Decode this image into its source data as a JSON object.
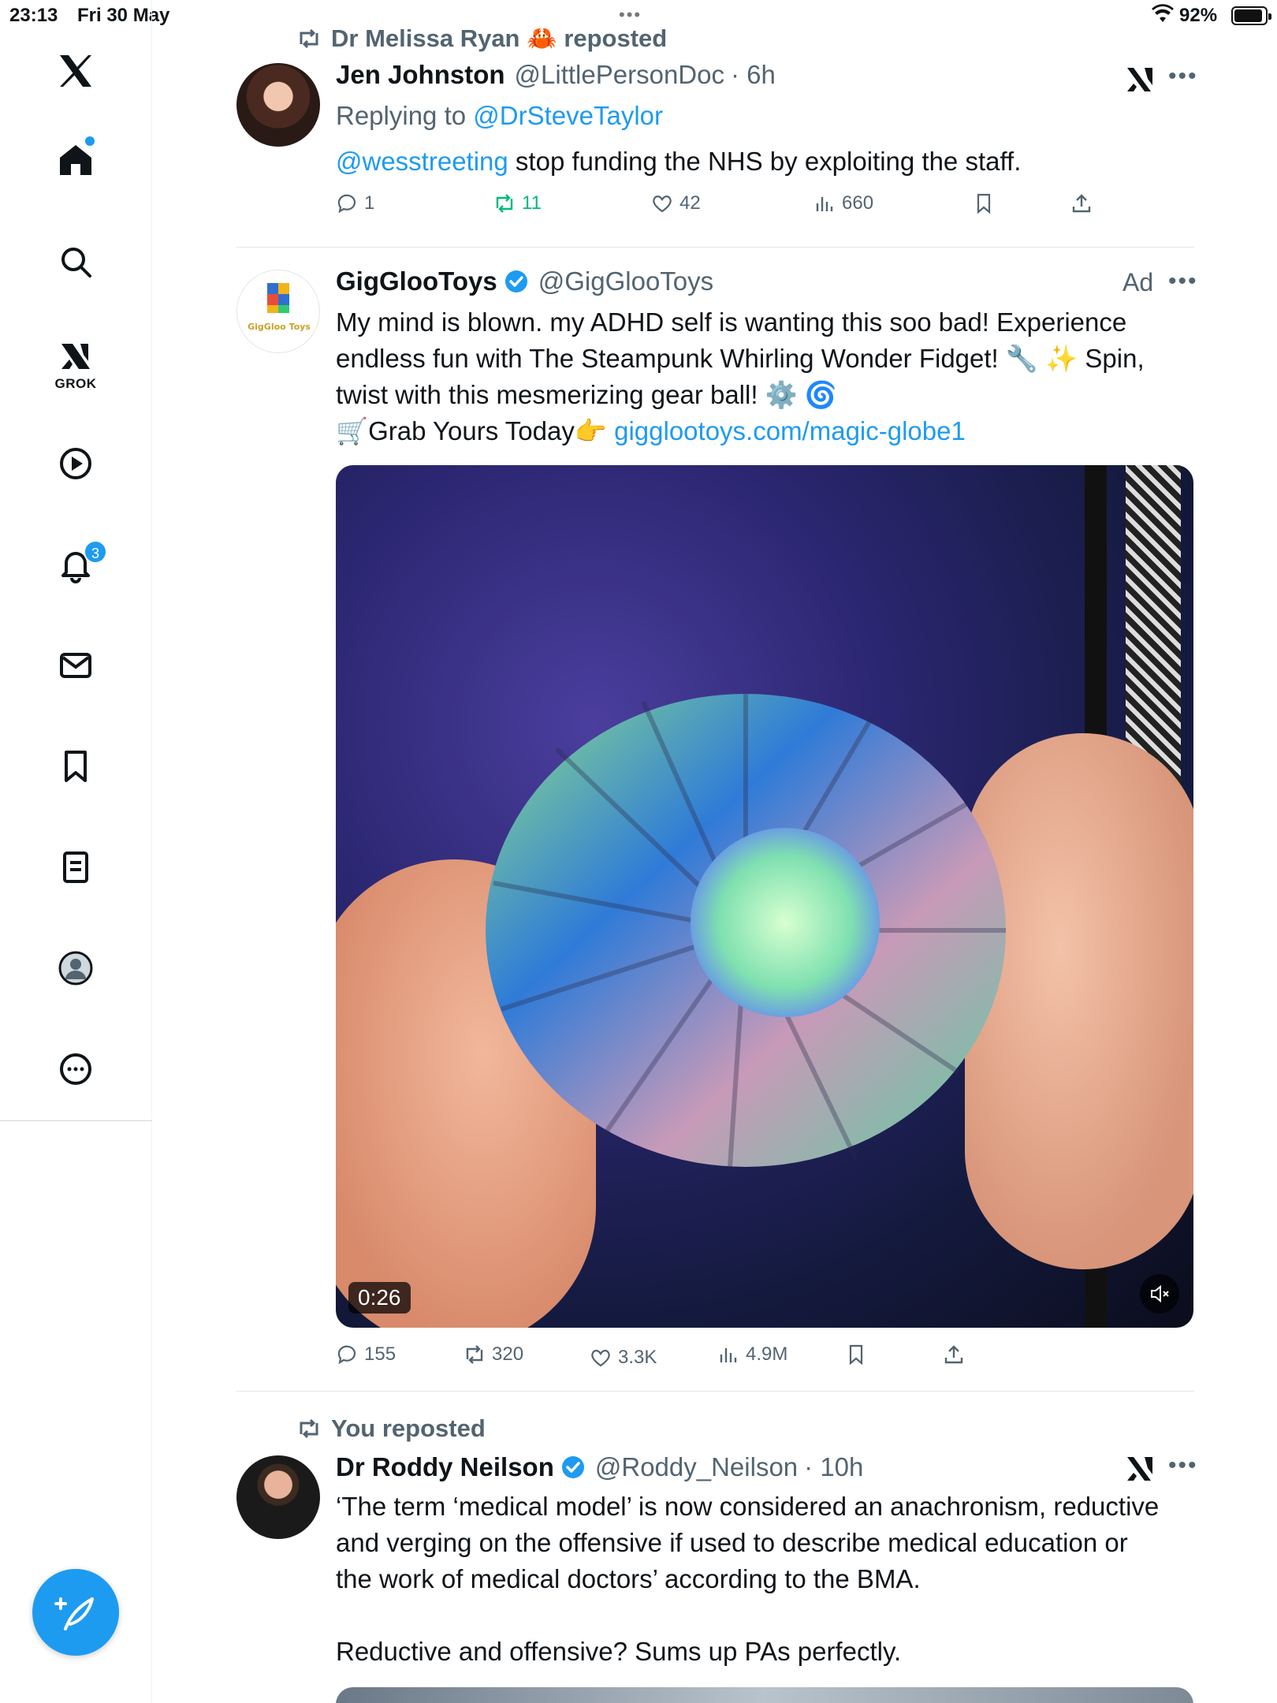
{
  "status_bar": {
    "time": "23:13",
    "date": "Fri 30 May",
    "battery": "92%"
  },
  "sidebar": {
    "grok_label": "GROK",
    "notification_count": "3",
    "items": [
      "home-icon",
      "search-icon",
      "grok-icon",
      "video-icon",
      "notifications-icon",
      "messages-icon",
      "bookmarks-icon",
      "lists-icon",
      "profile-icon",
      "more-icon"
    ]
  },
  "tweets": [
    {
      "repost_by": "Dr Melissa Ryan 🦀 reposted",
      "name": "Jen Johnston",
      "handle": "@LittlePersonDoc",
      "time": "· 6h",
      "replying_prefix": "Replying to",
      "replying_to": "@DrSteveTaylor",
      "mention": "@wesstreeting",
      "text": " stop funding the NHS by exploiting the staff.",
      "stats": {
        "replies": "1",
        "reposts": "11",
        "likes": "42",
        "views": "660"
      }
    },
    {
      "name": "GigGlooToys",
      "handle": "@GigGlooToys",
      "ad_label": "Ad",
      "avatar_text": "GigGloo Toys",
      "lines": [
        "My mind is blown. my ADHD self is wanting this soo bad! Experience",
        "endless fun with The Steampunk Whirling Wonder Fidget! 🔧 ✨ Spin,",
        "twist with this mesmerizing gear ball! ⚙️ 🌀"
      ],
      "cta": "🛒Grab Yours Today👉 ",
      "link": "gigglootoys.com/magic-globe1",
      "video_duration": "0:26",
      "stats": {
        "replies": "155",
        "reposts": "320",
        "likes": "3.3K",
        "views": "4.9M"
      }
    },
    {
      "repost_by": "You reposted",
      "name": "Dr Roddy Neilson",
      "handle": "@Roddy_Neilson",
      "time": "· 10h",
      "lines": [
        "‘The term ‘medical model’ is now considered an anachronism, reductive",
        "and verging on the offensive if used to describe medical education or",
        "the work of medical doctors’ according to the BMA."
      ],
      "last_line": "Reductive and offensive? Sums up PAs perfectly."
    }
  ],
  "colors": {
    "accent": "#1d9bf0",
    "repost_green": "#00ba7c",
    "muted": "#536471"
  }
}
